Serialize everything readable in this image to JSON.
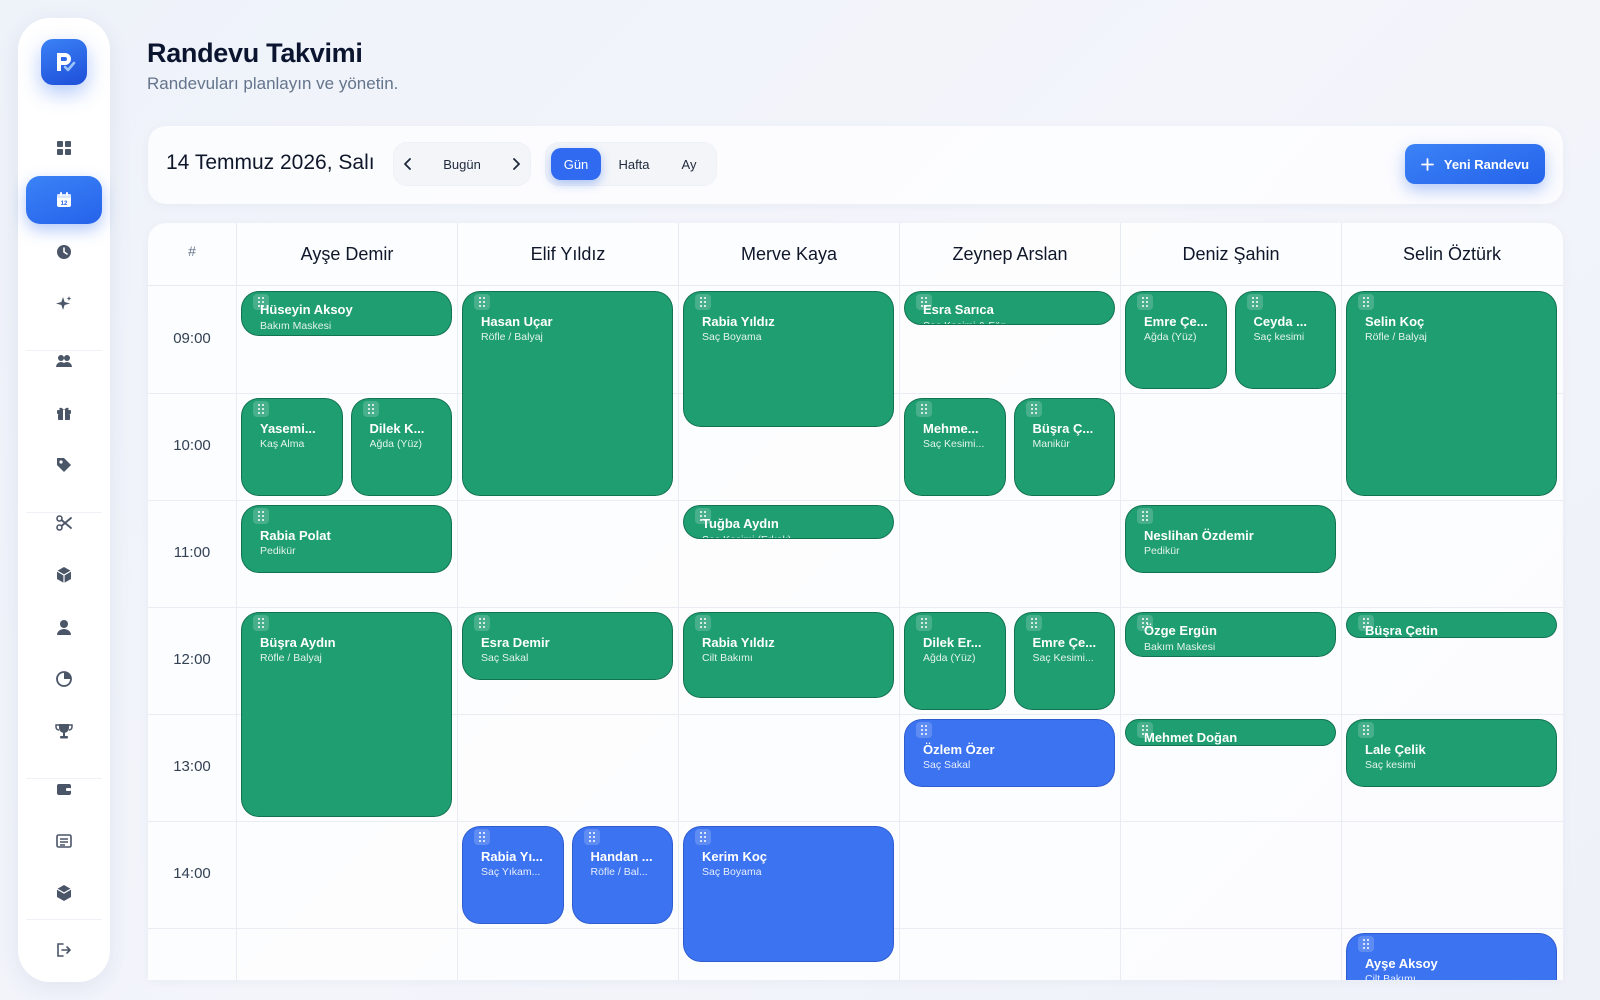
{
  "app": {
    "logo_letter": "R"
  },
  "header": {
    "title": "Randevu Takvimi",
    "subtitle": "Randevuları planlayın ve yönetin."
  },
  "sidebar": {
    "items": [
      {
        "icon": "dashboard-grid-icon",
        "active": false
      },
      {
        "icon": "calendar-icon",
        "active": true,
        "badge": "12"
      },
      {
        "icon": "clock-icon",
        "active": false
      },
      {
        "icon": "sparkle-icon",
        "active": false
      },
      {
        "icon": "users-icon",
        "active": false
      },
      {
        "icon": "gift-icon",
        "active": false
      },
      {
        "icon": "tag-icon",
        "active": false
      },
      {
        "icon": "scissors-icon",
        "active": false
      },
      {
        "icon": "package-icon",
        "active": false
      },
      {
        "icon": "user-icon",
        "active": false
      },
      {
        "icon": "chart-pie-icon",
        "active": false
      },
      {
        "icon": "trophy-icon",
        "active": false
      },
      {
        "icon": "wallet-icon",
        "active": false
      },
      {
        "icon": "receipt-icon",
        "active": false
      },
      {
        "icon": "box-icon",
        "active": false
      },
      {
        "icon": "logout-icon",
        "active": false
      }
    ]
  },
  "toolbar": {
    "current_date": "14 Temmuz 2026, Salı",
    "today_label": "Bugün",
    "views": [
      "Gün",
      "Hafta",
      "Ay"
    ],
    "active_view": "Gün",
    "new_button_label": "Yeni Randevu"
  },
  "calendar": {
    "hash_label": "#",
    "staff": [
      "Ayşe Demir",
      "Elif Yıldız",
      "Merve Kaya",
      "Zeynep Arslan",
      "Deniz Şahin",
      "Selin Öztürk"
    ],
    "times": [
      "09:00",
      "10:00",
      "11:00",
      "12:00",
      "13:00",
      "14:00"
    ],
    "appointments": [
      {
        "staff": 0,
        "start": "09:00",
        "duration_min": 25,
        "client": "Hüseyin Aksoy",
        "service": "Bakım Maskesi",
        "color": "green",
        "lane": 0,
        "lanes": 1
      },
      {
        "staff": 0,
        "start": "10:00",
        "duration_min": 55,
        "client": "Yasemi...",
        "service": "Kaş Alma",
        "color": "green",
        "lane": 0,
        "lanes": 2
      },
      {
        "staff": 0,
        "start": "10:00",
        "duration_min": 55,
        "client": "Dilek K...",
        "service": "Ağda (Yüz)",
        "color": "green",
        "lane": 1,
        "lanes": 2
      },
      {
        "staff": 0,
        "start": "11:00",
        "duration_min": 38,
        "client": "Rabia Polat",
        "service": "Pedikür",
        "color": "green",
        "lane": 0,
        "lanes": 1
      },
      {
        "staff": 0,
        "start": "12:00",
        "duration_min": 115,
        "client": "Büşra Aydın",
        "service": "Röfle / Balyaj",
        "color": "green",
        "lane": 0,
        "lanes": 1
      },
      {
        "staff": 1,
        "start": "09:00",
        "duration_min": 115,
        "client": "Hasan Uçar",
        "service": "Röfle / Balyaj",
        "color": "green",
        "lane": 0,
        "lanes": 1
      },
      {
        "staff": 1,
        "start": "12:00",
        "duration_min": 38,
        "client": "Esra Demir",
        "service": "Saç Sakal",
        "color": "green",
        "lane": 0,
        "lanes": 1
      },
      {
        "staff": 1,
        "start": "14:00",
        "duration_min": 55,
        "client": "Rabia Yı...",
        "service": "Saç Yıkam...",
        "color": "blue",
        "lane": 0,
        "lanes": 2
      },
      {
        "staff": 1,
        "start": "14:00",
        "duration_min": 55,
        "client": "Handan ...",
        "service": "Röfle / Bal...",
        "color": "blue",
        "lane": 1,
        "lanes": 2
      },
      {
        "staff": 2,
        "start": "09:00",
        "duration_min": 76,
        "client": "Rabia Yıldız",
        "service": "Saç Boyama",
        "color": "green",
        "lane": 0,
        "lanes": 1
      },
      {
        "staff": 2,
        "start": "11:00",
        "duration_min": 19,
        "client": "Tuğba Aydın",
        "service": "Saç Kesimi (Erkek)",
        "color": "green",
        "lane": 0,
        "lanes": 1
      },
      {
        "staff": 2,
        "start": "12:00",
        "duration_min": 48,
        "client": "Rabia Yıldız",
        "service": "Cilt Bakımı",
        "color": "green",
        "lane": 0,
        "lanes": 1
      },
      {
        "staff": 2,
        "start": "14:00",
        "duration_min": 76,
        "client": "Kerim Koç",
        "service": "Saç Boyama",
        "color": "blue",
        "lane": 0,
        "lanes": 1
      },
      {
        "staff": 3,
        "start": "09:00",
        "duration_min": 19,
        "client": "Esra Sarıca",
        "service": "Saç Kesimi & Fön",
        "color": "green",
        "lane": 0,
        "lanes": 1
      },
      {
        "staff": 3,
        "start": "10:00",
        "duration_min": 55,
        "client": "Mehme...",
        "service": "Saç Kesimi...",
        "color": "green",
        "lane": 0,
        "lanes": 2
      },
      {
        "staff": 3,
        "start": "10:00",
        "duration_min": 55,
        "client": "Büşra Ç...",
        "service": "Manikür",
        "color": "green",
        "lane": 1,
        "lanes": 2
      },
      {
        "staff": 3,
        "start": "12:00",
        "duration_min": 55,
        "client": "Dilek Er...",
        "service": "Ağda (Yüz)",
        "color": "green",
        "lane": 0,
        "lanes": 2
      },
      {
        "staff": 3,
        "start": "12:00",
        "duration_min": 55,
        "client": "Emre Çe...",
        "service": "Saç Kesimi...",
        "color": "green",
        "lane": 1,
        "lanes": 2
      },
      {
        "staff": 3,
        "start": "13:00",
        "duration_min": 38,
        "client": "Özlem Özer",
        "service": "Saç Sakal",
        "color": "blue",
        "lane": 0,
        "lanes": 1
      },
      {
        "staff": 4,
        "start": "09:00",
        "duration_min": 55,
        "client": "Emre Çe...",
        "service": "Ağda (Yüz)",
        "color": "green",
        "lane": 0,
        "lanes": 2
      },
      {
        "staff": 4,
        "start": "09:00",
        "duration_min": 55,
        "client": "Ceyda ...",
        "service": "Saç kesimi",
        "color": "green",
        "lane": 1,
        "lanes": 2
      },
      {
        "staff": 4,
        "start": "11:00",
        "duration_min": 38,
        "client": "Neslihan Özdemir",
        "service": "Pedikür",
        "color": "green",
        "lane": 0,
        "lanes": 1
      },
      {
        "staff": 4,
        "start": "12:00",
        "duration_min": 25,
        "client": "Özge Ergün",
        "service": "Bakım Maskesi",
        "color": "green",
        "lane": 0,
        "lanes": 1
      },
      {
        "staff": 4,
        "start": "13:00",
        "duration_min": 15,
        "client": "Mehmet Doğan",
        "service": "",
        "color": "green",
        "lane": 0,
        "lanes": 1
      },
      {
        "staff": 5,
        "start": "09:00",
        "duration_min": 115,
        "client": "Selin Koç",
        "service": "Röfle / Balyaj",
        "color": "green",
        "lane": 0,
        "lanes": 1
      },
      {
        "staff": 5,
        "start": "12:00",
        "duration_min": 12,
        "client": "Büşra Çetin",
        "service": "",
        "color": "green",
        "lane": 0,
        "lanes": 1
      },
      {
        "staff": 5,
        "start": "13:00",
        "duration_min": 38,
        "client": "Lale Çelik",
        "service": "Saç kesimi",
        "color": "green",
        "lane": 0,
        "lanes": 1
      },
      {
        "staff": 5,
        "start": "15:00",
        "duration_min": 40,
        "client": "Ayşe Aksoy",
        "service": "Cilt Bakımı",
        "color": "blue",
        "lane": 0,
        "lanes": 1
      }
    ]
  },
  "colors": {
    "accent": "#2563eb",
    "appointment_green": "#1f9e72",
    "appointment_blue": "#3b73f0",
    "sidebar_icon": "#4a5568"
  }
}
